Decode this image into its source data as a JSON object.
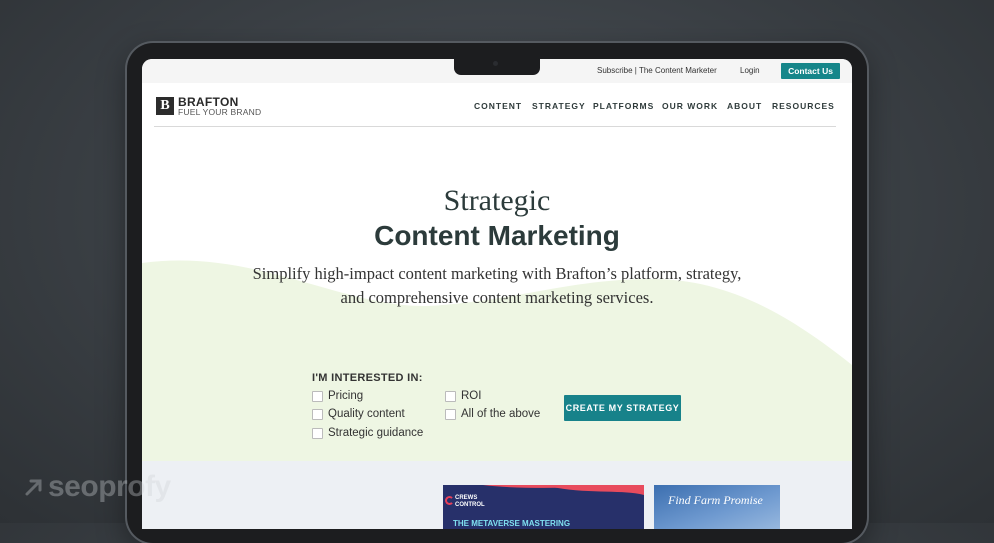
{
  "utility": {
    "subscribe": "Subscribe | The Content Marketer",
    "login": "Login",
    "contact": "Contact Us"
  },
  "brand": {
    "initial": "B",
    "name": "BRAFTON",
    "tagline": "FUEL YOUR BRAND"
  },
  "nav": [
    "CONTENT",
    "STRATEGY",
    "PLATFORMS",
    "OUR WORK",
    "ABOUT",
    "RESOURCES"
  ],
  "hero": {
    "title_line1": "Strategic",
    "title_line2": "Content Marketing",
    "subtitle_line1": "Simplify high-impact content marketing with Brafton’s platform, strategy,",
    "subtitle_line2": "and comprehensive content marketing services."
  },
  "form": {
    "heading": "I'M INTERESTED IN:",
    "options": [
      "Pricing",
      "Quality content",
      "Strategic guidance",
      "ROI",
      "All of the above"
    ],
    "cta": "CREATE MY STRATEGY"
  },
  "cards": {
    "card1_brand_line1": "CREWS",
    "card1_brand_line2": "CONTROL",
    "card1_text": "THE METAVERSE MASTERING",
    "card2_text": "Find Farm Promise"
  },
  "watermark": "seoprofy",
  "colors": {
    "accent": "#16868a",
    "hero_band": "#eef6e3",
    "bezel": "#1c1d1f"
  }
}
